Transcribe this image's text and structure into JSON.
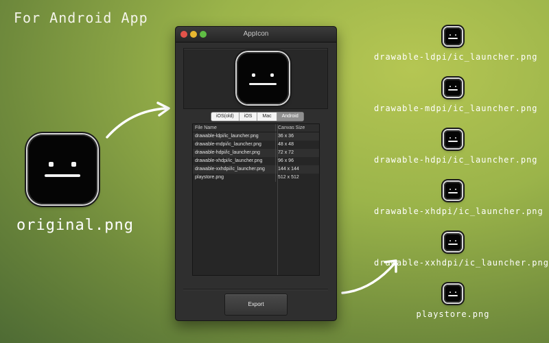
{
  "heading": "For Android App",
  "original": {
    "label": "original.png",
    "icon": "neutral-face-icon"
  },
  "window": {
    "title": "AppIcon",
    "tabs": [
      {
        "label": "iOS(old)",
        "active": false
      },
      {
        "label": "iOS",
        "active": false
      },
      {
        "label": "Mac",
        "active": false
      },
      {
        "label": "Android",
        "active": true
      }
    ],
    "table": {
      "headers": [
        "File Name",
        "Canvas Size"
      ],
      "rows": [
        [
          "drawable-ldpi/ic_launcher.png",
          "36 x 36"
        ],
        [
          "drawable-mdpi/ic_launcher.png",
          "48 x 48"
        ],
        [
          "drawable-hdpi/ic_launcher.png",
          "72 x 72"
        ],
        [
          "drawable-xhdpi/ic_launcher.png",
          "96 x 96"
        ],
        [
          "drawable-xxhdpi/ic_launcher.png",
          "144 x 144"
        ],
        [
          "playstore.png",
          "512 x 512"
        ]
      ]
    },
    "export_label": "Export"
  },
  "outputs": [
    "drawable-ldpi/ic_launcher.png",
    "drawable-mdpi/ic_launcher.png",
    "drawable-hdpi/ic_launcher.png",
    "drawable-xhdpi/ic_launcher.png",
    "drawable-xxhdpi/ic_launcher.png",
    "playstore.png"
  ]
}
